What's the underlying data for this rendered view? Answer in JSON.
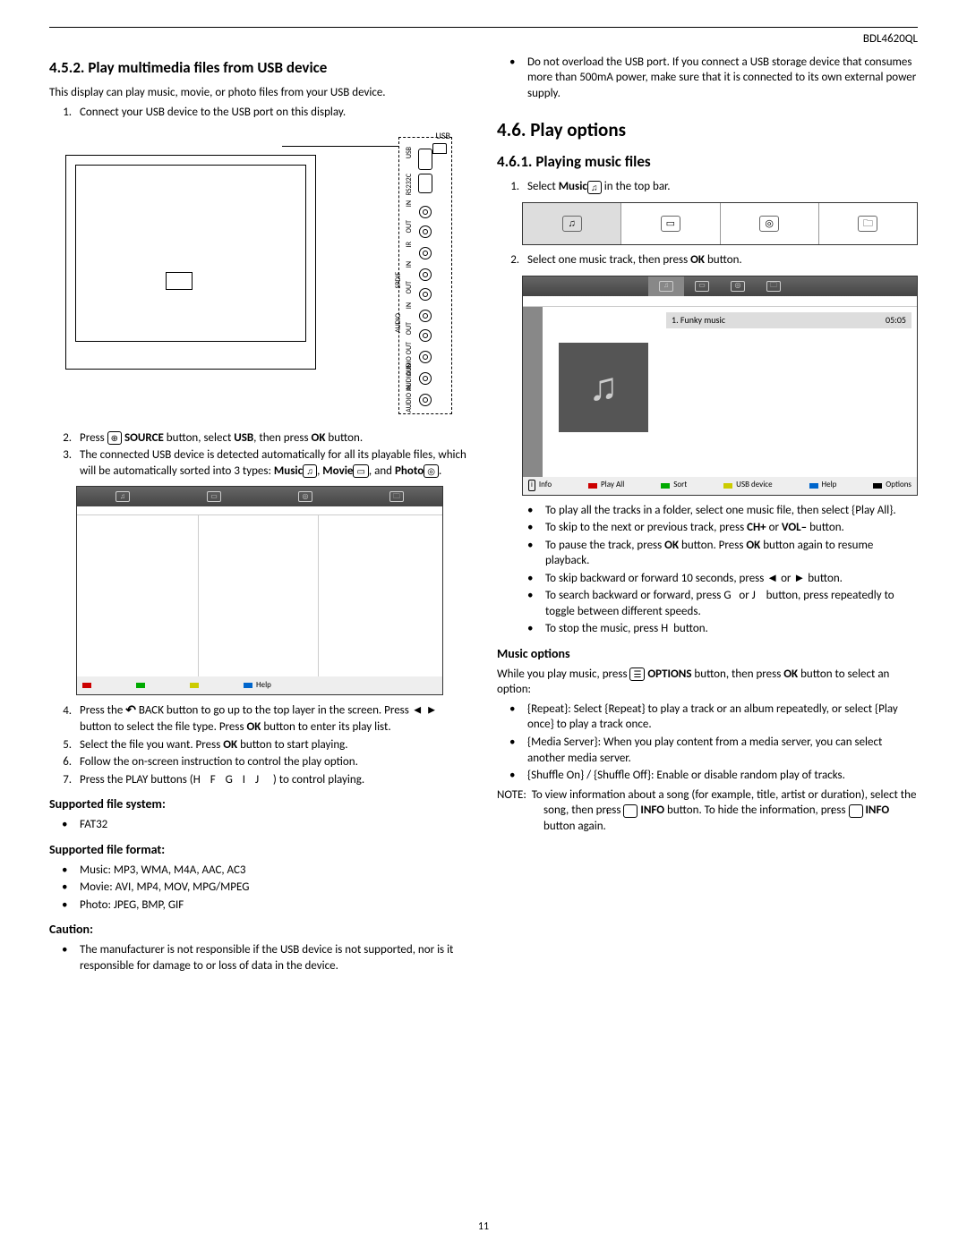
{
  "model": "BDL4620QL",
  "page_number": "11",
  "left": {
    "h_452": "4.5.2.  Play multimedia files from USB device",
    "intro": "This display can play music, movie, or photo files from your USB device.",
    "step1": "Connect your USB device to the USB port on this display.",
    "usb_label": "USB",
    "ports": [
      "USB",
      "RS232C",
      "IN",
      "OUT",
      "IR",
      "IN",
      "OUT",
      "SPDIF",
      "IN",
      "OUT",
      "AUDIO OUT",
      "AUDIO IN",
      "AUDIO IN"
    ],
    "step2_a": "Press ",
    "step2_b": " SOURCE",
    "step2_c": " button, select ",
    "step2_d": "USB",
    "step2_e": ", then press ",
    "step2_f": "OK",
    "step2_g": " button.",
    "step3_a": "The connected USB device is detected automatically for all its playable files, which will be automatically sorted into 3 types: ",
    "step3_music": "Music",
    "step3_movie": "Movie",
    "step3_and": ", and ",
    "step3_photo": "Photo",
    "step3_period": ".",
    "fig1_help": "Help",
    "step4_a": "Press the ",
    "step4_b": " BACK button to go up to the top layer in the screen. Press ",
    "step4_c": " button to select the file type. Press ",
    "step4_d": "OK",
    "step4_e": " button to enter its play list.",
    "step5_a": "Select the file you want. Press ",
    "step5_b": "OK",
    "step5_c": " button to start playing.",
    "step6": "Follow the on-screen instruction to control the play option.",
    "step7_a": "Press the PLAY buttons (",
    "step7_keys": "H  F  G  I  J",
    "step7_b": ") to control playing.",
    "h_sfs": "Supported file system:",
    "sfs1": "FAT32",
    "h_sff": "Supported file format:",
    "sff1_a": "Music",
    "sff1_b": ": MP3, WMA, M4A, AAC, AC3",
    "sff2_a": "Movie",
    "sff2_b": ": AVI, MP4, MOV, MPG/MPEG",
    "sff3_a": "Photo",
    "sff3_b": ": JPEG, BMP, GIF",
    "h_caution": "Caution:",
    "caution1": "The manufacturer is not responsible if the USB device is not supported, nor is it responsible for damage to or loss of data in the device."
  },
  "right": {
    "overload": "Do not overload the USB port. If you connect a USB storage device that consumes more than 500mA power, make sure that it is connected to its own external power supply.",
    "h_46": "4.6.    Play options",
    "h_461": "4.6.1.  Playing music files",
    "s1_a": "Select ",
    "s1_b": "Music",
    "s1_c": " in the top bar.",
    "s2_a": "Select one music track, then press ",
    "s2_b": "OK",
    "s2_c": " button.",
    "track_name": "1.  Funky music",
    "track_time": "05:05",
    "foot_info": "Info",
    "foot_playall": "Play All",
    "foot_sort": "Sort",
    "foot_usb": "USB device",
    "foot_help": "Help",
    "foot_options": "Options",
    "b1_a": "To play all the tracks in a folder, select one music file, then select {",
    "b1_b": "Play All",
    "b1_c": "}.",
    "b2_a": "To skip to the next or previous track, press ",
    "b2_b": "CH+",
    "b2_c": " or ",
    "b2_d": "VOL–",
    "b2_e": " button.",
    "b3_a": "To pause the track, press ",
    "b3_b": "OK",
    "b3_c": " button. Press ",
    "b3_d": "OK",
    "b3_e": " button again to resume playback.",
    "b4": "To skip backward or forward 10 seconds, press ◄ or ► button.",
    "b5_a": "To search backward or forward, press ",
    "b5_g": "G",
    "b5_or": " or ",
    "b5_j": "J",
    "b5_b": " button, press repeatedly to toggle between different speeds.",
    "b6_a": "To stop the music, press ",
    "b6_h": "H",
    "b6_b": " button.",
    "h_mopt": "Music options",
    "mopt_p_a": "While you play music, press ",
    "mopt_p_b": " OPTIONS",
    "mopt_p_c": " button, then press ",
    "mopt_p_d": "OK",
    "mopt_p_e": " button to select an option:",
    "mb1_a": "{",
    "mb1_b": "Repeat",
    "mb1_c": "}: Select {",
    "mb1_d": "Repeat",
    "mb1_e": "} to play a track or an album repeatedly, or select {",
    "mb1_f": "Play once",
    "mb1_g": "} to play a track once.",
    "mb2_a": "{",
    "mb2_b": "Media Server",
    "mb2_c": "}: When you play content from a media server, you can select another media server.",
    "mb3_a": "{",
    "mb3_b": "Shuffle On",
    "mb3_c": "} / {",
    "mb3_d": "Shuffle Off",
    "mb3_e": "}: Enable or disable random play of tracks.",
    "note_label": "NOTE:",
    "note_a": "To view information about a song (for example, title, artist or duration), select the song, then press ",
    "note_b": " INFO",
    "note_c": " button. To hide the information, press ",
    "note_d": " INFO",
    "note_e": " button again."
  }
}
